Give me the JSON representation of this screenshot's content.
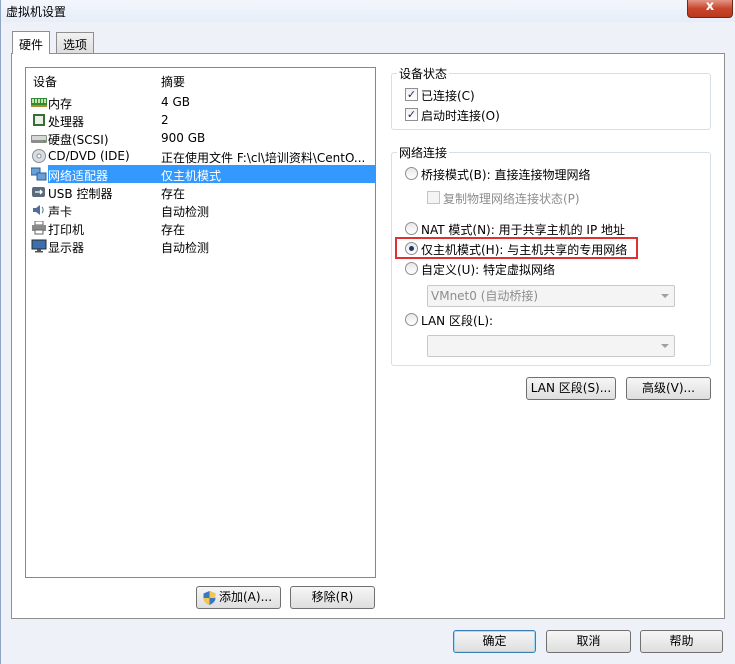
{
  "window": {
    "title": "虚拟机设置",
    "close_label": "x"
  },
  "tabs": [
    {
      "label": "硬件"
    },
    {
      "label": "选项"
    }
  ],
  "devices": {
    "header_device": "设备",
    "header_summary": "摘要",
    "rows": [
      {
        "name": "内存",
        "summary": "4 GB",
        "icon": "memory-icon"
      },
      {
        "name": "处理器",
        "summary": "2",
        "icon": "cpu-icon"
      },
      {
        "name": "硬盘(SCSI)",
        "summary": "900 GB",
        "icon": "harddisk-icon"
      },
      {
        "name": "CD/DVD (IDE)",
        "summary": "正在使用文件 F:\\cl\\培训资料\\CentO...",
        "icon": "cdrom-icon"
      },
      {
        "name": "网络适配器",
        "summary": "仅主机模式",
        "icon": "network-adapter-icon"
      },
      {
        "name": "USB 控制器",
        "summary": "存在",
        "icon": "usb-icon"
      },
      {
        "name": "声卡",
        "summary": "自动检测",
        "icon": "sound-icon"
      },
      {
        "name": "打印机",
        "summary": "存在",
        "icon": "printer-icon"
      },
      {
        "name": "显示器",
        "summary": "自动检测",
        "icon": "display-icon"
      }
    ],
    "selected_index": 4
  },
  "device_buttons": {
    "add": "添加(A)...",
    "remove": "移除(R)"
  },
  "device_status": {
    "title": "设备状态",
    "connected": {
      "label": "已连接(C)",
      "checked": true
    },
    "connect_at_power_on": {
      "label": "启动时连接(O)",
      "checked": true
    }
  },
  "network": {
    "title": "网络连接",
    "bridged": {
      "label": "桥接模式(B): 直接连接物理网络",
      "checked": false
    },
    "replicate": {
      "label": "复制物理网络连接状态(P)",
      "checked": false
    },
    "nat": {
      "label": "NAT 模式(N): 用于共享主机的 IP 地址",
      "checked": false
    },
    "host_only": {
      "label": "仅主机模式(H): 与主机共享的专用网络",
      "checked": true
    },
    "custom": {
      "label": "自定义(U): 特定虚拟网络",
      "checked": false
    },
    "custom_select": "VMnet0 (自动桥接)",
    "lan_segment": {
      "label": "LAN 区段(L):",
      "checked": false
    },
    "lan_select": ""
  },
  "network_buttons": {
    "lan_segments": "LAN 区段(S)...",
    "advanced": "高级(V)..."
  },
  "footer": {
    "ok": "确定",
    "cancel": "取消",
    "help": "帮助"
  },
  "colors": {
    "selection": "#3399ff",
    "highlight_border": "#e03030",
    "window_bg": "#eef2f8"
  }
}
